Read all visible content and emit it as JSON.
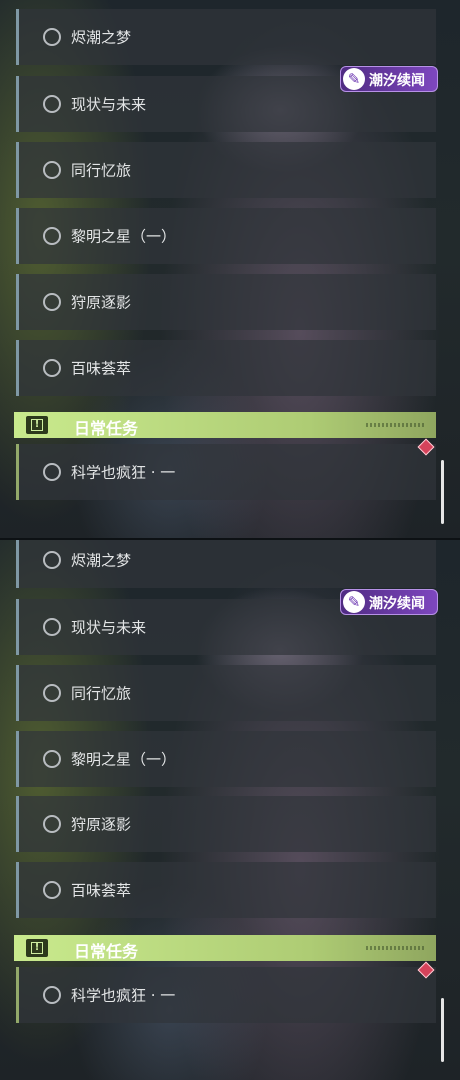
{
  "panels": [
    {
      "event_badge": {
        "label": "潮汐续闻",
        "icon": "feather-icon"
      },
      "quests": [
        "烬潮之梦",
        "现状与未来",
        "同行忆旅",
        "黎明之星（一）",
        "狩原逐影",
        "百味荟萃"
      ],
      "daily_section": {
        "title": "日常任务",
        "icon": "exclamation-icon",
        "quests": [
          "科学也疯狂 · 一"
        ]
      }
    },
    {
      "event_badge": {
        "label": "潮汐续闻",
        "icon": "feather-icon"
      },
      "quests": [
        "烬潮之梦",
        "现状与未来",
        "同行忆旅",
        "黎明之星（一）",
        "狩原逐影",
        "百味荟萃"
      ],
      "daily_section": {
        "title": "日常任务",
        "icon": "exclamation-icon",
        "quests": [
          "科学也疯狂 · 一"
        ]
      }
    }
  ],
  "colors": {
    "section_accent": "#c9ea8d",
    "badge_purple": "#7e47bf",
    "marker_red": "#d6435b",
    "item_border": "#7f98a4"
  }
}
